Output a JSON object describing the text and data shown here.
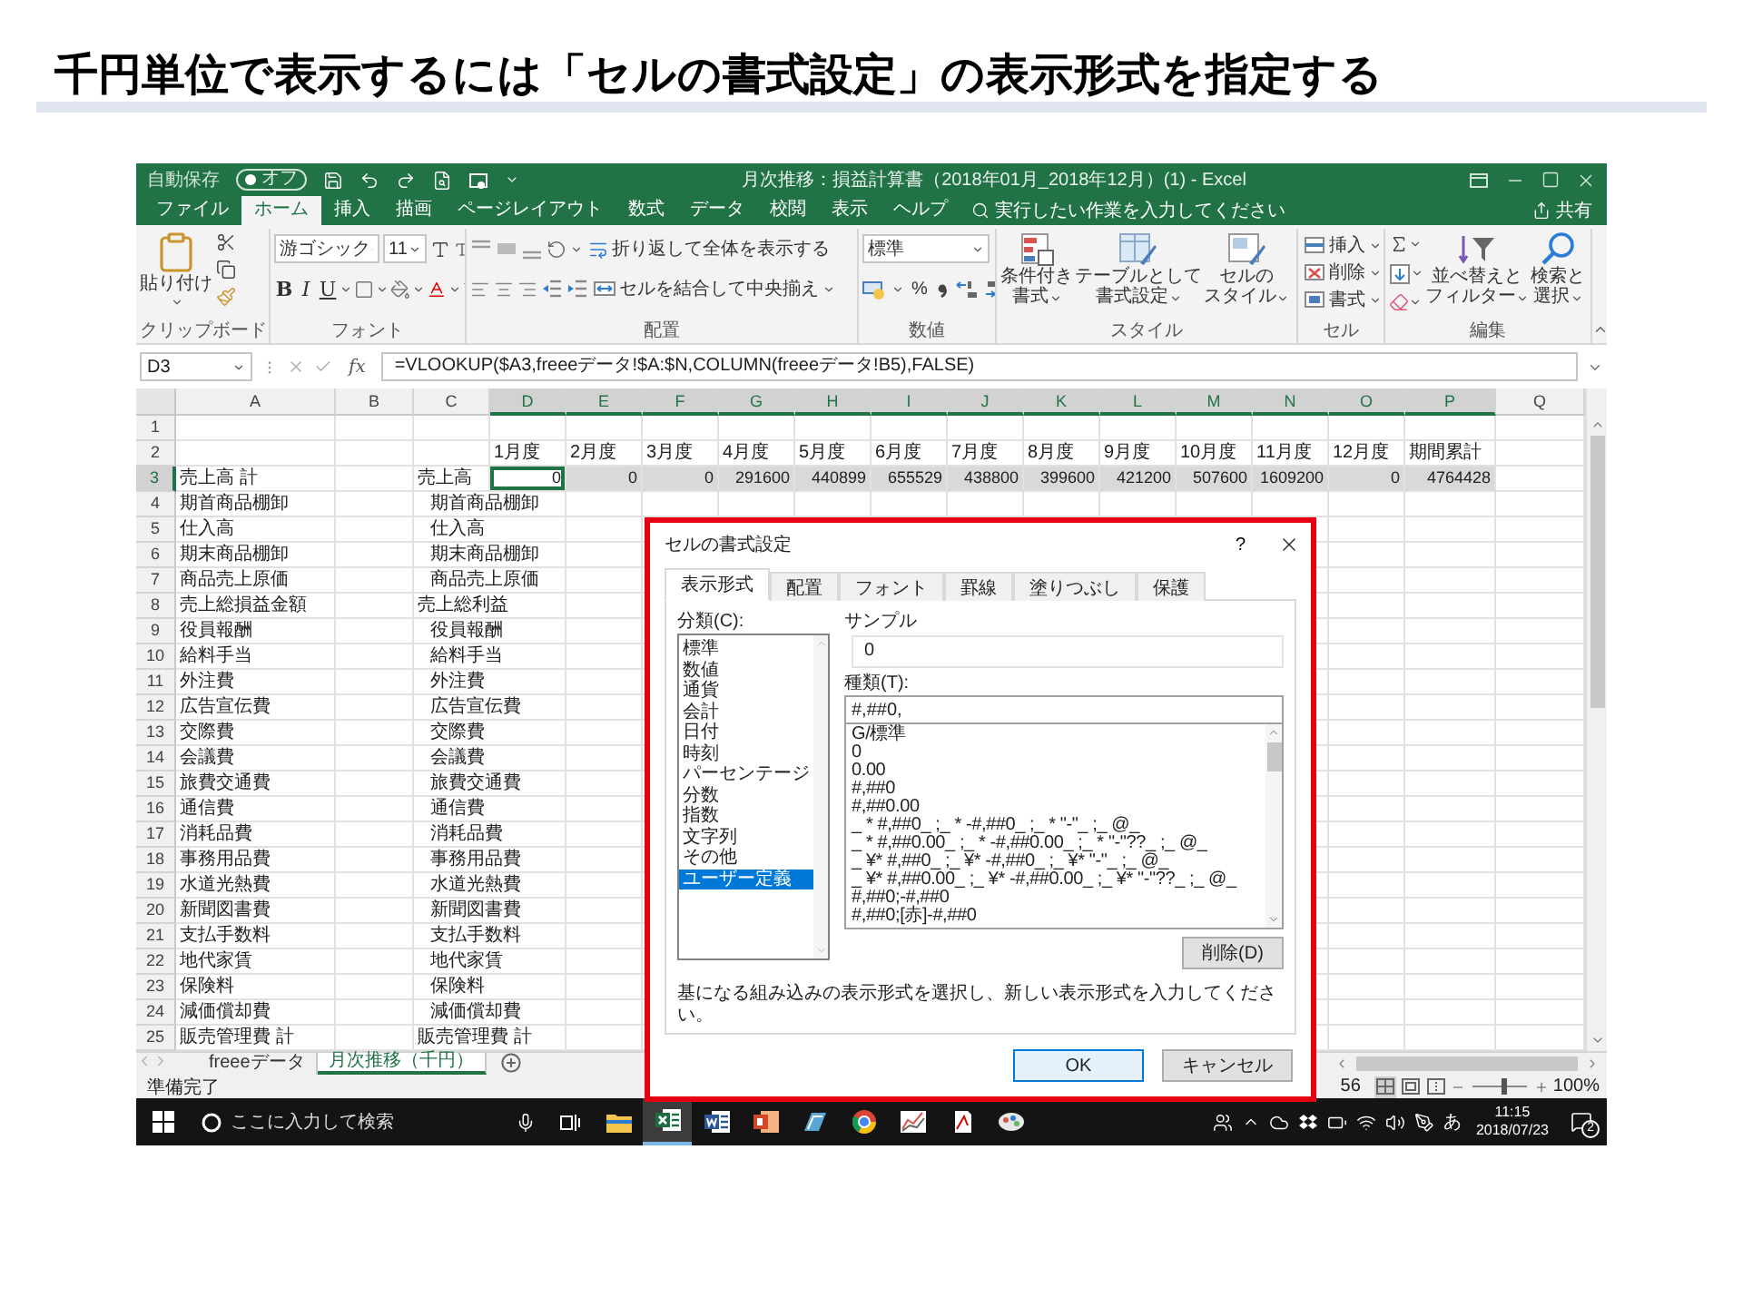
{
  "slide_title": "千円単位で表示するには「セルの書式設定」の表示形式を指定する",
  "excel": {
    "autosave": {
      "label": "自動保存",
      "state_label": "オフ",
      "on": false
    },
    "title": "月次推移：損益計算書（2018年01月_2018年12月）(1) - Excel",
    "ribbon_tabs": [
      {
        "label": "ファイル",
        "selected": false
      },
      {
        "label": "ホーム",
        "selected": true
      },
      {
        "label": "挿入",
        "selected": false
      },
      {
        "label": "描画",
        "selected": false
      },
      {
        "label": "ページレイアウト",
        "selected": false
      },
      {
        "label": "数式",
        "selected": false
      },
      {
        "label": "データ",
        "selected": false
      },
      {
        "label": "校閲",
        "selected": false
      },
      {
        "label": "表示",
        "selected": false
      },
      {
        "label": "ヘルプ",
        "selected": false
      }
    ],
    "tell_me": "実行したい作業を入力してください",
    "share": "共有",
    "ribbon": {
      "clipboard": {
        "paste": "貼り付け",
        "label": "クリップボード"
      },
      "font": {
        "name": "游ゴシック",
        "size": "11",
        "bold": "B",
        "italic": "I",
        "underline": "U",
        "label": "フォント"
      },
      "alignment": {
        "wrap": "折り返して全体を表示する",
        "merge": "セルを結合して中央揃え",
        "label": "配置"
      },
      "number": {
        "format": "標準",
        "percent": "%",
        "label": "数値"
      },
      "styles": {
        "buttons": [
          {
            "kind": "conditional",
            "lines": [
              "条件付き",
              "書式"
            ]
          },
          {
            "kind": "table",
            "lines": [
              "テーブルとして",
              "書式設定"
            ]
          },
          {
            "kind": "cell",
            "lines": [
              "セルの",
              "スタイル"
            ]
          }
        ],
        "label": "スタイル"
      },
      "cells": {
        "buttons": [
          {
            "kind": "insert",
            "label": "挿入"
          },
          {
            "kind": "delete",
            "label": "削除"
          },
          {
            "kind": "format",
            "label": "書式"
          }
        ],
        "label": "セル"
      },
      "editing": {
        "buttons": [
          {
            "kind": "sort",
            "lines": [
              "並べ替えと",
              "フィルター"
            ]
          },
          {
            "kind": "find",
            "lines": [
              "検索と",
              "選択"
            ]
          }
        ],
        "label": "編集"
      }
    },
    "name_box": "D3",
    "fx": "fx",
    "formula": "=VLOOKUP($A3,freeeデータ!$A:$N,COLUMN(freeeデータ!B5),FALSE)",
    "columns": [
      {
        "label": "A",
        "selected": false
      },
      {
        "label": "B",
        "selected": false
      },
      {
        "label": "C",
        "selected": false
      },
      {
        "label": "D",
        "selected": true
      },
      {
        "label": "E",
        "selected": true
      },
      {
        "label": "F",
        "selected": true
      },
      {
        "label": "G",
        "selected": true
      },
      {
        "label": "H",
        "selected": true
      },
      {
        "label": "I",
        "selected": true
      },
      {
        "label": "J",
        "selected": true
      },
      {
        "label": "K",
        "selected": true
      },
      {
        "label": "L",
        "selected": true
      },
      {
        "label": "M",
        "selected": true
      },
      {
        "label": "N",
        "selected": true
      },
      {
        "label": "O",
        "selected": true
      },
      {
        "label": "P",
        "selected": true
      },
      {
        "label": "Q",
        "selected": false
      }
    ],
    "rows": [
      {
        "number": "1",
        "selected": false
      },
      {
        "number": "2",
        "selected": false,
        "labels": [
          "1月度",
          "2月度",
          "3月度",
          "4月度",
          "5月度",
          "6月度",
          "7月度",
          "8月度",
          "9月度",
          "10月度",
          "11月度",
          "12月度",
          "期間累計"
        ]
      },
      {
        "number": "3",
        "selected": true,
        "a": "売上高 計",
        "c": "売上高",
        "c_indented": false,
        "values": [
          {
            "text": "0",
            "active": true
          },
          {
            "text": "0",
            "active": false
          },
          {
            "text": "0",
            "active": false
          },
          {
            "text": "291600",
            "active": false
          },
          {
            "text": "440899",
            "active": false
          },
          {
            "text": "655529",
            "active": false
          },
          {
            "text": "438800",
            "active": false
          },
          {
            "text": "399600",
            "active": false
          },
          {
            "text": "421200",
            "active": false
          },
          {
            "text": "507600",
            "active": false
          },
          {
            "text": "1609200",
            "active": false
          },
          {
            "text": "0",
            "active": false
          },
          {
            "text": "4764428",
            "active": false
          }
        ]
      },
      {
        "number": "4",
        "selected": false,
        "a": "期首商品棚卸",
        "c": "期首商品棚卸",
        "c_indented": true
      },
      {
        "number": "5",
        "selected": false,
        "a": "仕入高",
        "c": "仕入高",
        "c_indented": true
      },
      {
        "number": "6",
        "selected": false,
        "a": "期末商品棚卸",
        "c": "期末商品棚卸",
        "c_indented": true
      },
      {
        "number": "7",
        "selected": false,
        "a": "商品売上原価",
        "c": "商品売上原価",
        "c_indented": true
      },
      {
        "number": "8",
        "selected": false,
        "a": "売上総損益金額",
        "c": "売上総利益",
        "c_indented": false
      },
      {
        "number": "9",
        "selected": false,
        "a": "役員報酬",
        "c": "役員報酬",
        "c_indented": true
      },
      {
        "number": "10",
        "selected": false,
        "a": "給料手当",
        "c": "給料手当",
        "c_indented": true
      },
      {
        "number": "11",
        "selected": false,
        "a": "外注費",
        "c": "外注費",
        "c_indented": true
      },
      {
        "number": "12",
        "selected": false,
        "a": "広告宣伝費",
        "c": "広告宣伝費",
        "c_indented": true
      },
      {
        "number": "13",
        "selected": false,
        "a": "交際費",
        "c": "交際費",
        "c_indented": true
      },
      {
        "number": "14",
        "selected": false,
        "a": "会議費",
        "c": "会議費",
        "c_indented": true
      },
      {
        "number": "15",
        "selected": false,
        "a": "旅費交通費",
        "c": "旅費交通費",
        "c_indented": true
      },
      {
        "number": "16",
        "selected": false,
        "a": "通信費",
        "c": "通信費",
        "c_indented": true
      },
      {
        "number": "17",
        "selected": false,
        "a": "消耗品費",
        "c": "消耗品費",
        "c_indented": true
      },
      {
        "number": "18",
        "selected": false,
        "a": "事務用品費",
        "c": "事務用品費",
        "c_indented": true
      },
      {
        "number": "19",
        "selected": false,
        "a": "水道光熱費",
        "c": "水道光熱費",
        "c_indented": true
      },
      {
        "number": "20",
        "selected": false,
        "a": "新聞図書費",
        "c": "新聞図書費",
        "c_indented": true
      },
      {
        "number": "21",
        "selected": false,
        "a": "支払手数料",
        "c": "支払手数料",
        "c_indented": true
      },
      {
        "number": "22",
        "selected": false,
        "a": "地代家賃",
        "c": "地代家賃",
        "c_indented": true
      },
      {
        "number": "23",
        "selected": false,
        "a": "保険料",
        "c": "保険料",
        "c_indented": true
      },
      {
        "number": "24",
        "selected": false,
        "a": "減価償却費",
        "c": "減価償却費",
        "c_indented": true
      },
      {
        "number": "25",
        "selected": false,
        "a": "販売管理費 計",
        "c": "販売管理費 計",
        "c_indented": false
      }
    ],
    "sheet_tabs": [
      {
        "label": "freeeデータ",
        "selected": false
      },
      {
        "label": "月次推移（千円）",
        "selected": true
      }
    ],
    "status": {
      "text": "準備完了",
      "count": "56",
      "views": [
        {
          "kind": "normal",
          "selected": true
        },
        {
          "kind": "layout",
          "selected": false
        },
        {
          "kind": "pagebreak",
          "selected": false
        }
      ],
      "zoom_slider": {
        "level": 0.55
      },
      "zoom": "100%"
    }
  },
  "dialog": {
    "title": "セルの書式設定",
    "help": "?",
    "tabs": [
      {
        "label": "表示形式",
        "selected": true
      },
      {
        "label": "配置",
        "selected": false
      },
      {
        "label": "フォント",
        "selected": false
      },
      {
        "label": "罫線",
        "selected": false
      },
      {
        "label": "塗りつぶし",
        "selected": false
      },
      {
        "label": "保護",
        "selected": false
      }
    ],
    "category_label": "分類(C):",
    "categories": [
      {
        "label": "標準",
        "selected": false
      },
      {
        "label": "数値",
        "selected": false
      },
      {
        "label": "通貨",
        "selected": false
      },
      {
        "label": "会計",
        "selected": false
      },
      {
        "label": "日付",
        "selected": false
      },
      {
        "label": "時刻",
        "selected": false
      },
      {
        "label": "パーセンテージ",
        "selected": false
      },
      {
        "label": "分数",
        "selected": false
      },
      {
        "label": "指数",
        "selected": false
      },
      {
        "label": "文字列",
        "selected": false
      },
      {
        "label": "その他",
        "selected": false
      },
      {
        "label": "ユーザー定義",
        "selected": true
      }
    ],
    "sample_label": "サンプル",
    "sample": "0",
    "type_label": "種類(T):",
    "type_value": "#,##0,",
    "formats": [
      "G/標準",
      "0",
      "0.00",
      "#,##0",
      "#,##0.00",
      "_ * #,##0_ ;_ * -#,##0_ ;_ * \"-\"_ ;_ @_",
      "_ * #,##0.00_ ;_ * -#,##0.00_ ;_ * \"-\"??_ ;_ @_",
      "_ ¥* #,##0_ ;_ ¥* -#,##0_ ;_ ¥* \"-\"_ ;_ @_",
      "_ ¥* #,##0.00_ ;_ ¥* -#,##0.00_ ;_ ¥* \"-\"??_ ;_ @_",
      "#,##0;-#,##0",
      "#,##0;[赤]-#,##0"
    ],
    "delete": "削除(D)",
    "description": "基になる組み込みの表示形式を選択し、新しい表示形式を入力してください。",
    "ok": "OK",
    "cancel": "キャンセル"
  },
  "taskbar": {
    "search_placeholder": "ここに入力して検索",
    "apps": [
      {
        "kind": "explorer",
        "active": false
      },
      {
        "kind": "excel",
        "active": true
      },
      {
        "kind": "word",
        "active": false
      },
      {
        "kind": "powerpoint",
        "active": false
      },
      {
        "kind": "notes",
        "active": false
      },
      {
        "kind": "browser",
        "active": false
      },
      {
        "kind": "chart",
        "active": false
      },
      {
        "kind": "document",
        "active": false
      },
      {
        "kind": "paint",
        "active": false
      }
    ],
    "ime": "あ",
    "time": "11:15",
    "date": "2018/07/23",
    "notifications": "2"
  }
}
